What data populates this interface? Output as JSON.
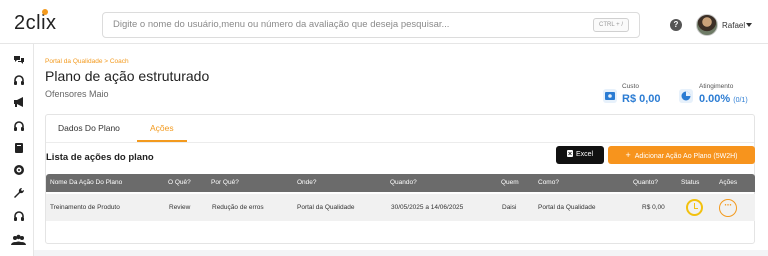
{
  "header": {
    "logo_text": "2clix",
    "search_placeholder": "Digite o nome do usuário,menu ou número da avaliação que deseja pesquisar...",
    "search_shortcut": "CTRL + /",
    "help_label": "?",
    "user_name": "Rafael"
  },
  "sidebar": {
    "icons": [
      "chat-icon",
      "headset-icon",
      "megaphone-icon",
      "headset-icon",
      "book-icon",
      "target-icon",
      "wrench-icon",
      "headset-icon",
      "users-icon"
    ]
  },
  "page": {
    "breadcrumb": "Portal da Qualidade > Coach",
    "title": "Plano de ação estruturado",
    "subtitle": "Ofensores Maio"
  },
  "kpis": {
    "cost": {
      "label": "Custo",
      "value": "R$ 0,00"
    },
    "achievement": {
      "label": "Atingimento",
      "value": "0.00%",
      "sub": "(0/1)"
    }
  },
  "tabs": [
    {
      "label": "Dados Do Plano",
      "active": false
    },
    {
      "label": "Ações",
      "active": true
    }
  ],
  "actions_list": {
    "title": "Lista de ações do plano",
    "excel_label": "Excel",
    "add_label": "Adicionar Ação Ao Plano (5W2H)",
    "columns": [
      "Nome Da Ação Do Plano",
      "O Quê?",
      "Por Quê?",
      "Onde?",
      "Quando?",
      "Quem",
      "Como?",
      "Quanto?",
      "Status",
      "Ações"
    ],
    "rows": [
      {
        "name": "Treinamento de Produto",
        "what": "Review",
        "why": "Redução de erros",
        "where": "Portal da Qualidade",
        "when": "30/05/2025 a 14/06/2025",
        "who": "Daisi",
        "how": "Portal da Qualidade",
        "how_much": "R$ 0,00",
        "status": "pending"
      }
    ]
  },
  "colors": {
    "accent": "#f39a1e",
    "kpi_blue": "#2b7cd3",
    "status_yellow": "#f2c10f",
    "table_header": "#6b6b6b"
  }
}
